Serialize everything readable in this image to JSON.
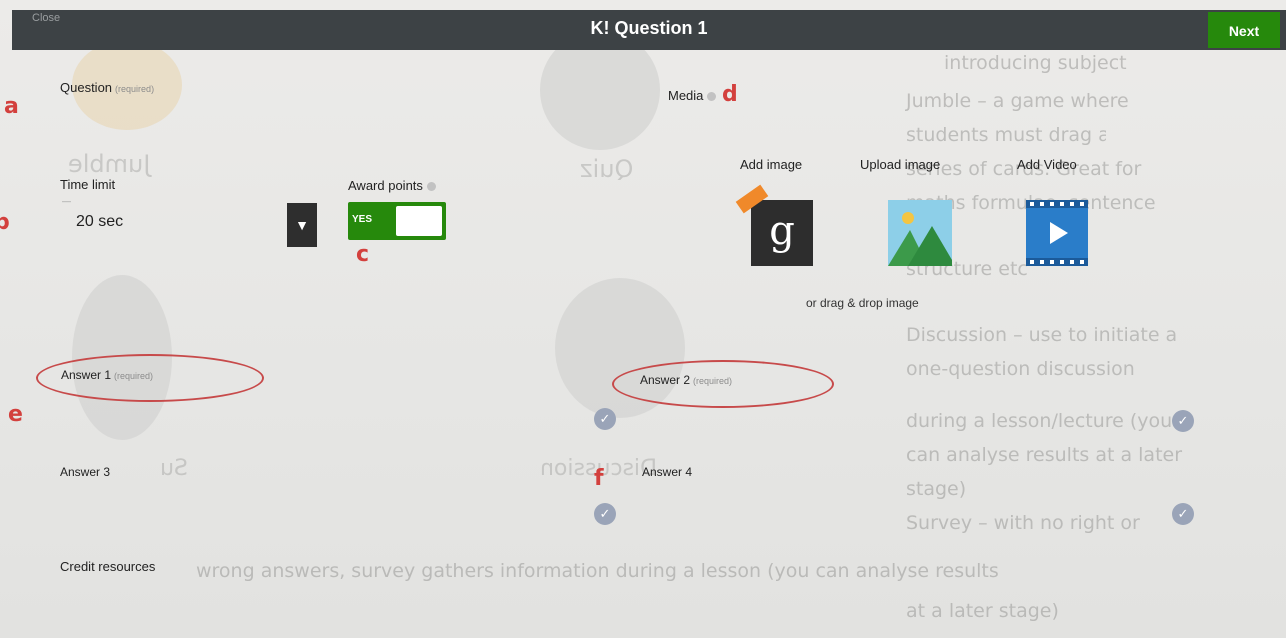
{
  "topbar": {
    "left_label": "Close",
    "title": "K! Question 1",
    "next_label": "Next"
  },
  "question": {
    "label": "Question",
    "required": "(required)"
  },
  "media": {
    "label": "Media"
  },
  "time_limit": {
    "label": "Time limit",
    "value": "20 sec"
  },
  "award_points": {
    "label": "Award points",
    "toggle_value": "YES"
  },
  "media_options": {
    "add_image": "Add image",
    "upload_image": "Upload image",
    "add_video": "Add Video",
    "drag_hint": "or drag & drop image"
  },
  "answers": [
    {
      "label": "Answer 1",
      "required": "(required)"
    },
    {
      "label": "Answer 2",
      "required": "(required)"
    },
    {
      "label": "Answer 3",
      "required": ""
    },
    {
      "label": "Answer 4",
      "required": ""
    }
  ],
  "credit": {
    "label": "Credit resources"
  },
  "annotations": [
    "a",
    "b",
    "c",
    "d",
    "e",
    "f"
  ],
  "bleed_through": {
    "right_column": [
      "introducing subject",
      "Jumble – a game where",
      "students must drag and drop a",
      "series of cards. Great for",
      "maths formulae, sentence",
      "structure etc",
      "Discussion – use to initiate a",
      "one-question discussion",
      "during a lesson/lecture (you",
      "can analyse results at a later",
      "stage)",
      "Survey – with no right or",
      "wrong answers, survey gathers information during a lesson (you can analyse results",
      "at a later stage)"
    ],
    "mid_words": [
      "Jumble",
      "Quiz",
      "Discussion",
      "Su"
    ]
  },
  "colors": {
    "bar": "#3d4245",
    "green": "#26890c",
    "annotation": "#d3403d",
    "ring": "#c74a4a"
  },
  "icons": [
    "g-icon",
    "upload-image-icon",
    "add-video-icon",
    "dropdown-arrow-icon",
    "check-icon",
    "info-icon"
  ]
}
